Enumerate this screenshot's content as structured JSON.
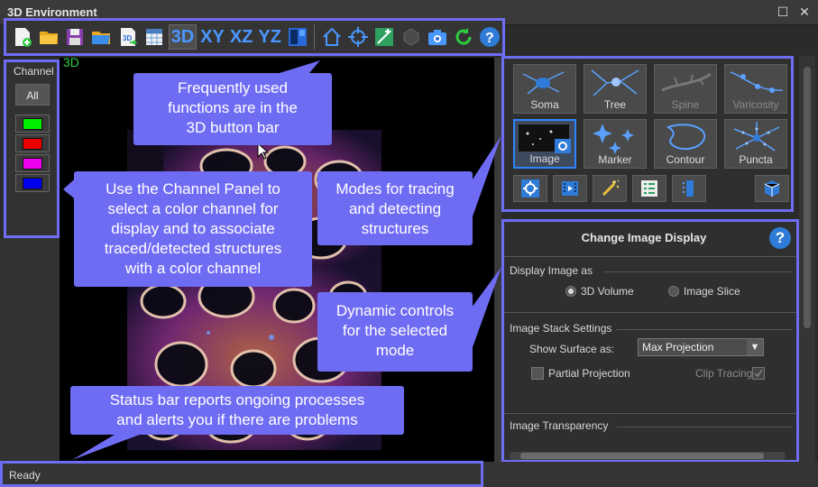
{
  "window": {
    "title": "3D Environment"
  },
  "toolbar": {
    "buttons": [
      "new-file-icon",
      "open-folder-icon",
      "save-icon",
      "open-data-icon",
      "export-3d-icon",
      "table-icon"
    ],
    "view_3d": "3D",
    "view_xy": "XY",
    "view_xz": "XZ",
    "view_yz": "YZ"
  },
  "channel": {
    "label": "Channel",
    "all_label": "All",
    "colors": [
      "#00ee00",
      "#ee0000",
      "#ee00ee",
      "#0000ee"
    ]
  },
  "viewer": {
    "label": "3D"
  },
  "modes": {
    "items": [
      {
        "label": "Soma"
      },
      {
        "label": "Tree"
      },
      {
        "label": "Spine"
      },
      {
        "label": "Varicosity"
      },
      {
        "label": "Image"
      },
      {
        "label": "Marker"
      },
      {
        "label": "Contour"
      },
      {
        "label": "Puncta"
      }
    ]
  },
  "dynamic": {
    "heading": "Change Image Display",
    "help": "?",
    "display_image_as": "Display Image as",
    "opt_3d_volume": "3D Volume",
    "opt_image_slice": "Image Slice",
    "stack_settings": "Image Stack Settings",
    "show_surface_label": "Show Surface as:",
    "show_surface_value": "Max Projection",
    "partial_projection": "Partial Projection",
    "clip_tracing": "Clip Tracing",
    "image_transparency": "Image Transparency"
  },
  "status": {
    "text": "Ready"
  },
  "callouts": {
    "toolbar": [
      "Frequently used",
      "functions are in the",
      "3D button bar"
    ],
    "channel": [
      "Use the Channel Panel to",
      "select a color channel for",
      "display and to associate",
      "traced/detected structures",
      "with a color channel"
    ],
    "modes": [
      "Modes for tracing",
      "and detecting",
      "structures"
    ],
    "dynamic": [
      "Dynamic controls",
      "for the selected",
      "mode"
    ],
    "status": [
      "Status bar reports ongoing processes",
      "and alerts you if there are problems"
    ]
  },
  "colors": {
    "accent": "#6f6cf4",
    "icon_blue": "#4a97ff"
  }
}
